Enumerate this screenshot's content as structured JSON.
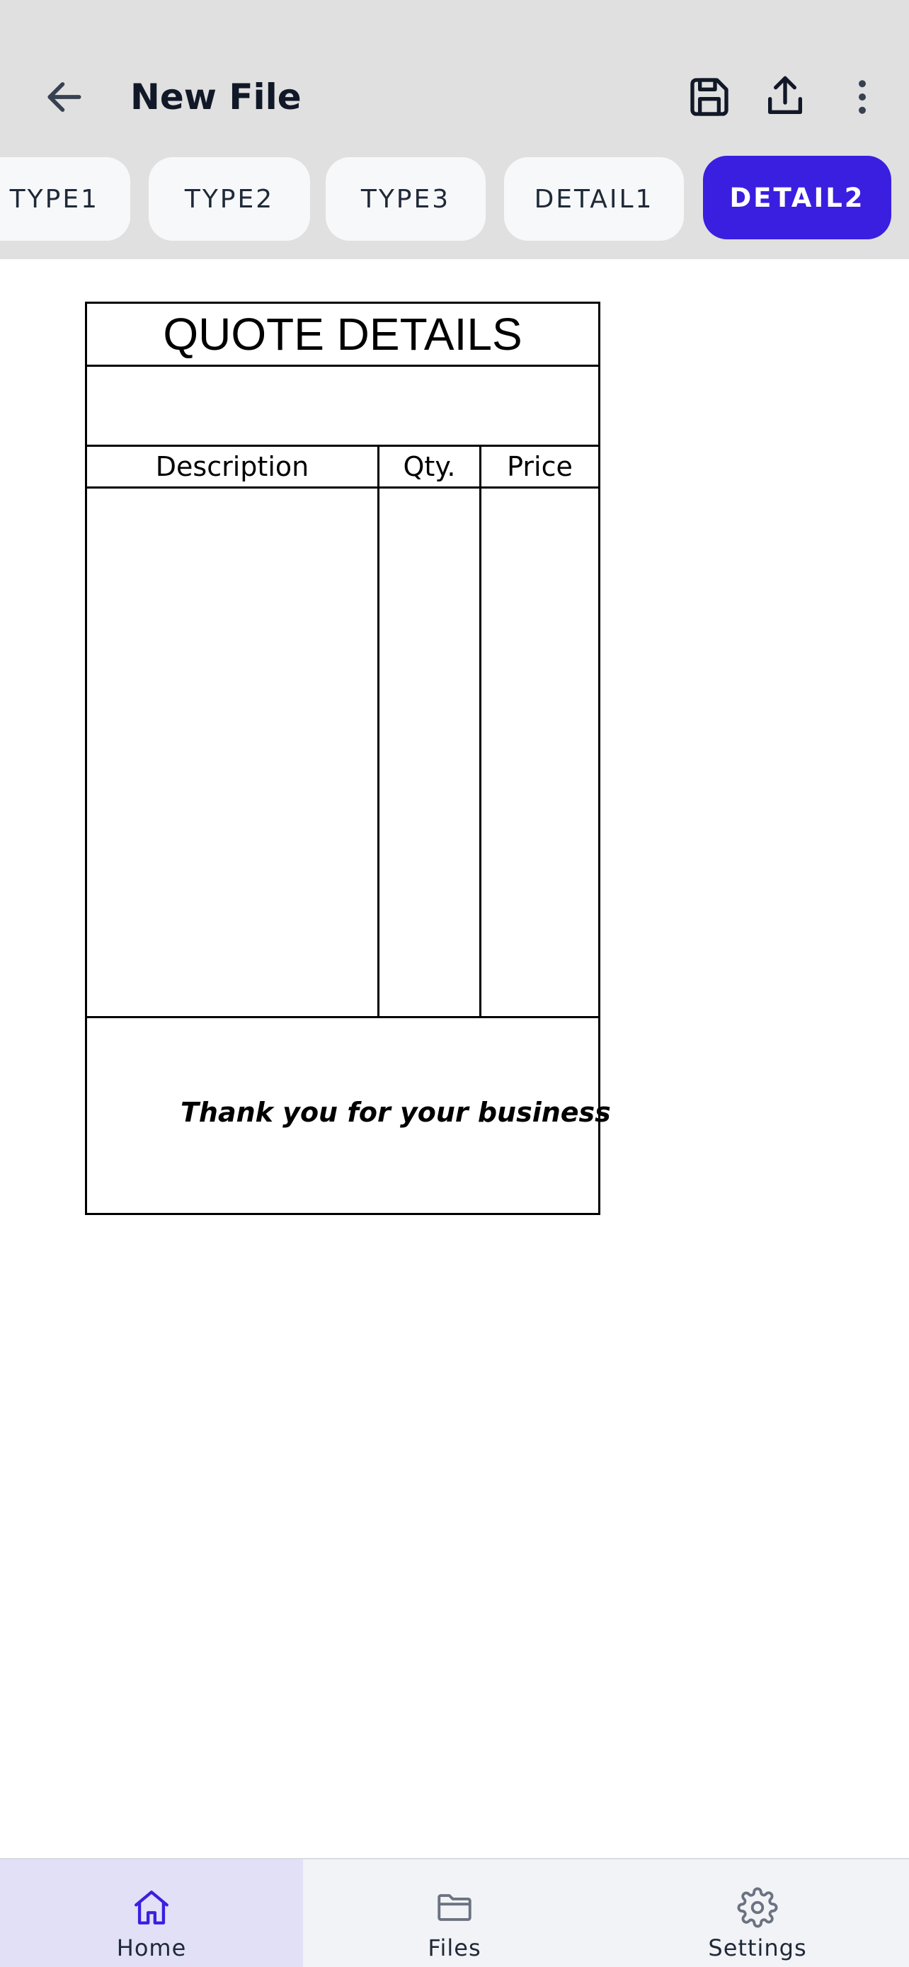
{
  "header": {
    "title": "New File",
    "back_icon": "arrow-left-icon",
    "actions": [
      "save-icon",
      "share-icon",
      "more-vertical-icon"
    ]
  },
  "chips": [
    {
      "label": "TYPE1",
      "selected": false
    },
    {
      "label": "TYPE2",
      "selected": false
    },
    {
      "label": "TYPE3",
      "selected": false
    },
    {
      "label": "DETAIL1",
      "selected": false
    },
    {
      "label": "DETAIL2",
      "selected": true
    }
  ],
  "document": {
    "title": "QUOTE DETAILS",
    "columns": [
      "Description",
      "Qty.",
      "Price"
    ],
    "footer_text": "Thank you for your business"
  },
  "bottom_nav": {
    "items": [
      {
        "label": "Home",
        "icon": "home-icon",
        "active": true
      },
      {
        "label": "Files",
        "icon": "folder-icon",
        "active": false
      },
      {
        "label": "Settings",
        "icon": "gear-icon",
        "active": false
      }
    ]
  },
  "colors": {
    "accent": "#3a1fe0",
    "appbar_bg": "#e0e0e0",
    "nav_active_bg": "#e1e0f6"
  }
}
